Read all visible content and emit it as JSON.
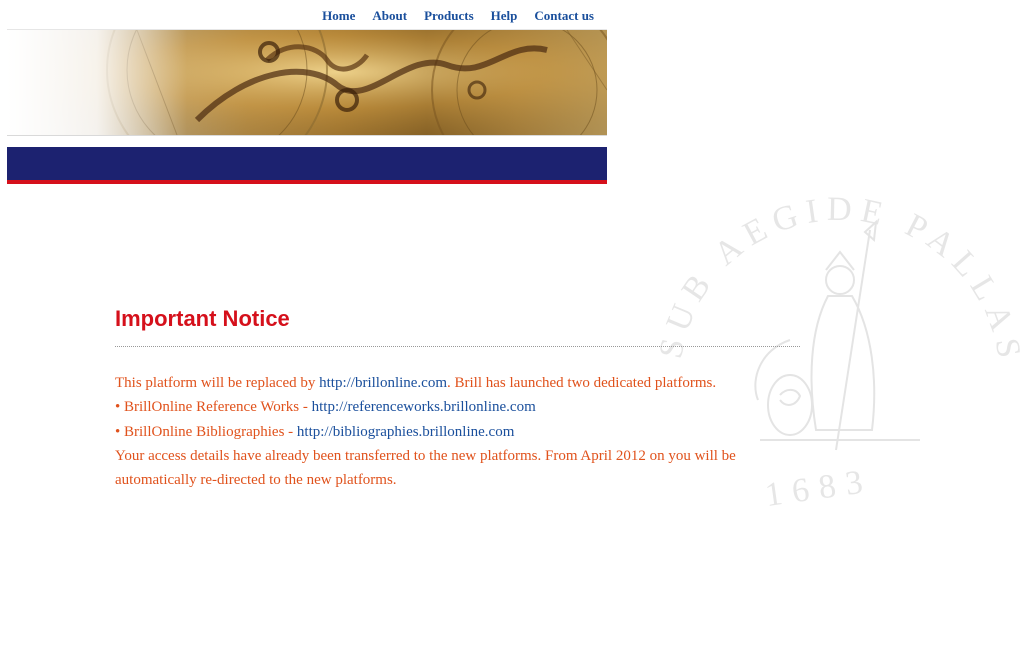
{
  "nav": {
    "items": [
      {
        "label": "Home"
      },
      {
        "label": "About"
      },
      {
        "label": "Products"
      },
      {
        "label": "Help"
      },
      {
        "label": "Contact us"
      }
    ]
  },
  "watermark": {
    "motto": "SUB AEGIDE PALLAS",
    "year": "1683"
  },
  "notice": {
    "title": "Important Notice",
    "line1_prefix": "This platform will be replaced by ",
    "line1_link": "http://brillonline.com",
    "line1_suffix": ". Brill has launched two dedicated platforms.",
    "line2_prefix": "• BrillOnline Reference Works - ",
    "line2_link": "http://referenceworks.brillonline.com",
    "line3_prefix": "• BrillOnline Bibliographies - ",
    "line3_link": "http://bibliographies.brillonline.com",
    "line4": "Your access details have already been transferred to the new platforms. From April 2012 on you will be automatically re-directed to the new platforms."
  },
  "colors": {
    "nav_link": "#1a4f9c",
    "title_red": "#d5101b",
    "body_orange": "#e0521c",
    "header_blue": "#1c2270"
  }
}
